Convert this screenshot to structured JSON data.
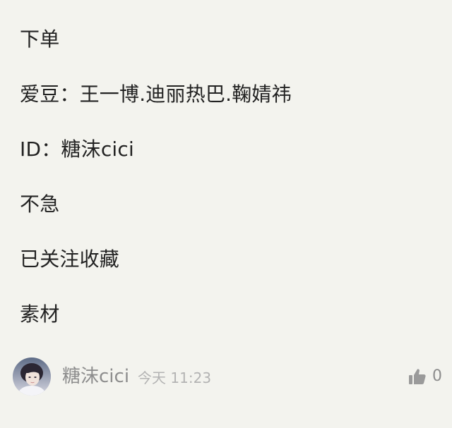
{
  "post": {
    "lines": [
      "下单",
      "爱豆：王一博.迪丽热巴.鞠婧祎",
      "ID：糖沫cici",
      "不急",
      "已关注收藏",
      "素材"
    ]
  },
  "comment": {
    "username": "糖沫cici",
    "timestamp": "今天 11:23",
    "like_count": "0",
    "avatar_icon": "user-avatar",
    "like_icon": "thumbs-up-icon"
  },
  "colors": {
    "background": "#f3f3ee",
    "text": "#222222",
    "muted": "#8d8d8d",
    "faint": "#b3b3b3"
  }
}
